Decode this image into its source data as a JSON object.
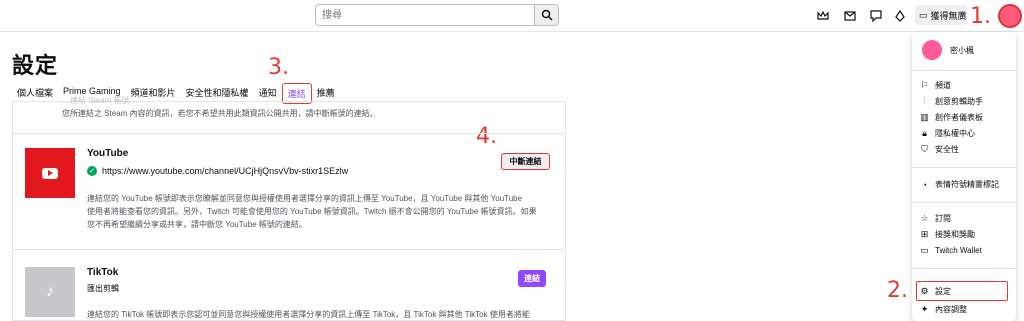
{
  "search": {
    "placeholder": "搜尋"
  },
  "topbar": {
    "get_label": "獲得無廣告"
  },
  "annotations": {
    "a1": "1.",
    "a2": "2.",
    "a3": "3.",
    "a4": "4."
  },
  "page": {
    "title": "設定"
  },
  "tabs": [
    {
      "label": "個人檔案"
    },
    {
      "label": "Prime Gaming"
    },
    {
      "label": "頻道和影片"
    },
    {
      "label": "安全性和隱私權"
    },
    {
      "label": "通知"
    },
    {
      "label": "連結"
    },
    {
      "label": "推薦"
    }
  ],
  "prev_text": {
    "line1": "…連結 Steam 帳號…",
    "line2": "您所連結之 Steam 內容的資訊，若您不希望共用此類資訊公開共用，請中斷帳號的連結。"
  },
  "youtube": {
    "name": "YouTube",
    "url": "https://www.youtube.com/channel/UCjHjQnsvVbv-stixr1SEzlw",
    "disconnect_label": "中斷連結",
    "desc1": "連結您的 YouTube 帳號即表示您瞭解並同意您與授權使用者選擇分享的資訊上傳至 YouTube，且 YouTube 與其他 YouTube",
    "desc2": "使用者將能查看您的資訊。另外，Twitch 可能會使用您的 YouTube 帳號資訊。Twitch 絕不會公開您的 YouTube 帳號資訊。如果",
    "desc3": "您不再希望繼續分享或共享，請中斷您 YouTube 帳號的連結。"
  },
  "tiktok": {
    "name": "TikTok",
    "sub": "匯出剪輯",
    "connect_label": "連結",
    "desc1": "連結您的 TikTok 帳號即表示您認可並同意您與授權使用者選擇分享的資訊上傳至 TikTok，且 TikTok 與其他 TikTok 使用者將能"
  },
  "menu": {
    "username": "密小楓",
    "items": [
      {
        "label": "頻道",
        "icon": "channel-icon"
      },
      {
        "label": "創意剪輯助手",
        "icon": "creator-icon"
      },
      {
        "label": "創作者儀表板",
        "icon": "dashboard-icon"
      },
      {
        "label": "隱私權中心",
        "icon": "lock-icon"
      },
      {
        "label": "安全性",
        "icon": "shield-icon"
      },
      {
        "label": "表情符號精靈標記",
        "icon": "emote-icon"
      },
      {
        "label": "訂閱",
        "icon": "star-icon"
      },
      {
        "label": "接獎和獎勵",
        "icon": "gift-icon"
      },
      {
        "label": "Twitch Wallet",
        "icon": "wallet-icon"
      },
      {
        "label": "設定",
        "icon": "gear-icon"
      },
      {
        "label": "內容調整",
        "icon": "sparkle-icon"
      }
    ]
  },
  "colors": {
    "accent": "#9147ff",
    "annotation": "#e23b2e",
    "youtube": "#e3181f"
  }
}
